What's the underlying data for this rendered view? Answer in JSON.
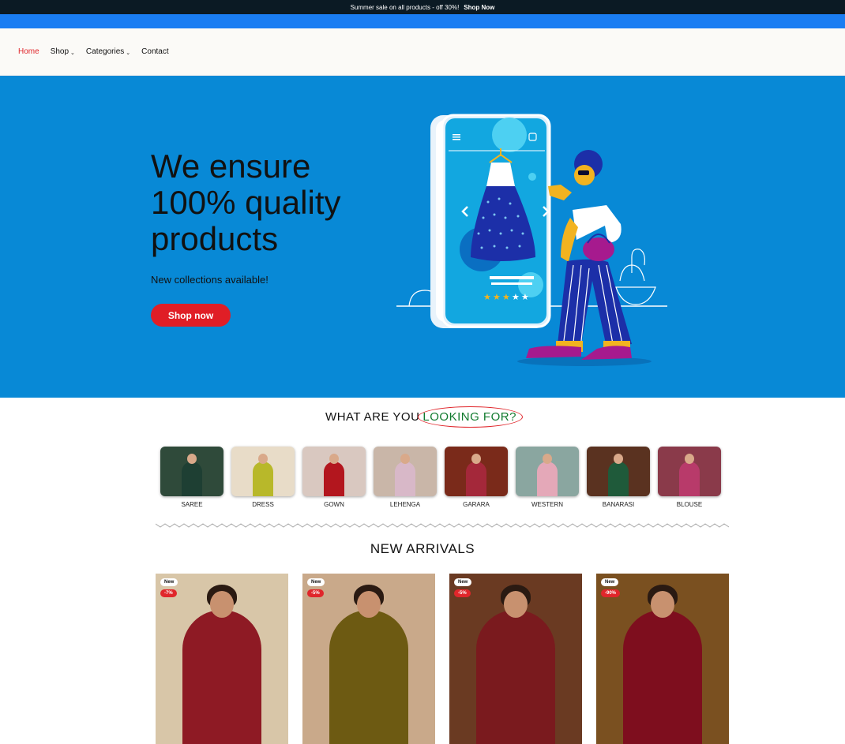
{
  "announcement": {
    "text": "Summer sale on all products - off 30%!",
    "link": "Shop Now"
  },
  "nav": {
    "items": [
      {
        "label": "Home",
        "active": true
      },
      {
        "label": "Shop",
        "dropdown": true
      },
      {
        "label": "Categories",
        "dropdown": true
      },
      {
        "label": "Contact"
      }
    ]
  },
  "hero": {
    "title_lines": [
      "We ensure",
      "100% quality",
      "products"
    ],
    "subtitle": "New collections available!",
    "button": "Shop now",
    "bg_color": "#0889d6",
    "button_color": "#e01e26"
  },
  "looking": {
    "prefix": "WHAT ARE YOU",
    "highlight": "LOOKING FOR?"
  },
  "categories": [
    {
      "label": "SAREE",
      "color": "#2f4a3a",
      "garment": "#1e3f33"
    },
    {
      "label": "DRESS",
      "color": "#e8dcc8",
      "garment": "#b8b82a"
    },
    {
      "label": "GOWN",
      "color": "#d9c8c0",
      "garment": "#b3161e"
    },
    {
      "label": "LEHENGA",
      "color": "#c9b6a8",
      "garment": "#d8b8c8"
    },
    {
      "label": "GARARA",
      "color": "#7a2a1a",
      "garment": "#a4283a"
    },
    {
      "label": "WESTERN",
      "color": "#8aa6a0",
      "garment": "#e4a8b8"
    },
    {
      "label": "BANARASI",
      "color": "#5a3220",
      "garment": "#1f5a3a"
    },
    {
      "label": "BLOUSE",
      "color": "#8a3a4a",
      "garment": "#b83a6a"
    }
  ],
  "new_arrivals": {
    "title": "NEW ARRIVALS",
    "products": [
      {
        "new": "New",
        "discount": "-7%",
        "bg": "#d8c6a8",
        "garment": "#8e1a24"
      },
      {
        "new": "New",
        "discount": "-5%",
        "bg": "#c9a98a",
        "garment": "#6d5a12"
      },
      {
        "new": "New",
        "discount": "-5%",
        "bg": "#6a3a22",
        "garment": "#7a1a1e"
      },
      {
        "new": "New",
        "discount": "-90%",
        "bg": "#7a5020",
        "garment": "#7e0e1e"
      }
    ]
  },
  "icons": {
    "menu": "hamburger-icon",
    "cart": "bag-icon",
    "chevron": "chevron-down-icon"
  }
}
